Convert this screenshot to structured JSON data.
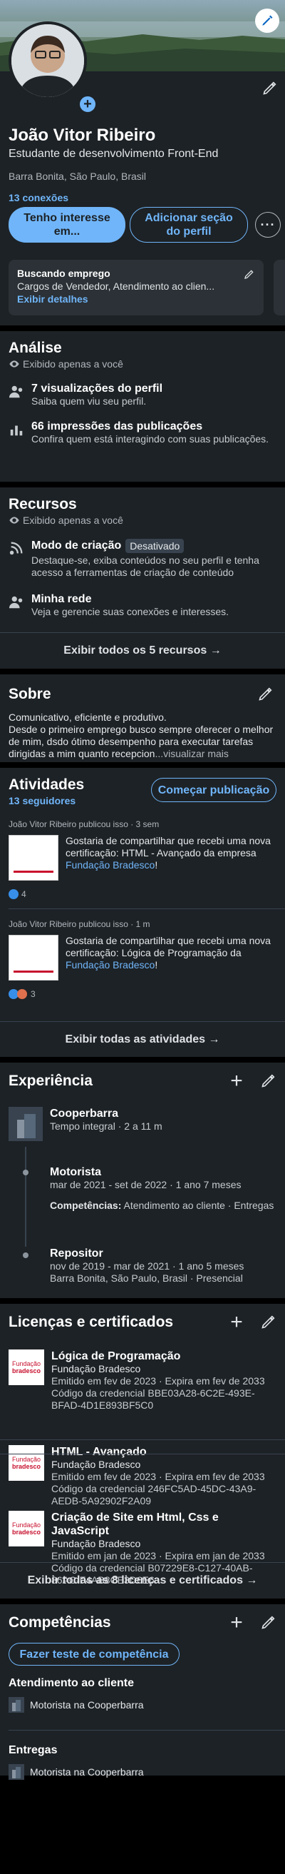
{
  "profile": {
    "name": "João Vitor Ribeiro",
    "headline": "Estudante de desenvolvimento Front-End",
    "location": "Barra Bonita, São Paulo, Brasil",
    "connections": "13 conexões",
    "btn_interest": "Tenho interesse em...",
    "btn_add_section": "Adicionar seção do perfil",
    "job_card": {
      "title": "Buscando emprego",
      "text": "Cargos de Vendedor, Atendimento ao clien...",
      "link": "Exibir detalhes"
    }
  },
  "analytics": {
    "title": "Análise",
    "private": "Exibido apenas a você",
    "items": [
      {
        "title": "7 visualizações do perfil",
        "sub": "Saiba quem viu seu perfil."
      },
      {
        "title": "66 impressões das publicações",
        "sub": "Confira quem está interagindo com suas publicações."
      }
    ]
  },
  "resources": {
    "title": "Recursos",
    "private": "Exibido apenas a você",
    "creator_title": "Modo de criação",
    "creator_badge": "Desativado",
    "creator_sub": "Destaque-se, exiba conteúdos no seu perfil e tenha acesso a ferramentas de criação de conteúdo",
    "network_title": "Minha rede",
    "network_sub": "Veja e gerencie suas conexões e interesses.",
    "show_all": "Exibir todos os 5 recursos →"
  },
  "about": {
    "title": "Sobre",
    "line1": "Comunicativo, eficiente e produtivo.",
    "line2": "Desde o primeiro emprego busco sempre oferecer o melhor de mim, dsdo ótimo desempenho para executar tarefas dirigidas a mim quanto recepcion",
    "more": "...visualizar mais"
  },
  "activity": {
    "title": "Atividades",
    "followers": "13 seguidores",
    "start_post": "Começar publicação",
    "posts": [
      {
        "header": "João Vitor Ribeiro publicou isso · 3 sem",
        "text": "Gostaria de compartilhar que recebi uma nova certificação: HTML - Avançado da empresa ",
        "org": "Fundação Bradesco",
        "tail": "!",
        "reactions": "4"
      },
      {
        "header": "João Vitor Ribeiro publicou isso · 1 m",
        "text": "Gostaria de compartilhar que recebi uma nova certificação: Lógica de Programação da ",
        "org": "Fundação Bradesco",
        "tail": "!",
        "reactions": "3"
      }
    ],
    "show_all": "Exibir todas as atividades →"
  },
  "experience": {
    "title": "Experiência",
    "company": "Cooperbarra",
    "company_sub": "Tempo integral · 2 a 11 m",
    "roles": [
      {
        "title": "Motorista",
        "dates": "mar de 2021 - set de 2022 · 1 ano 7 meses",
        "skills_label": "Competências:",
        "skills": " Atendimento ao cliente · Entregas"
      },
      {
        "title": "Repositor",
        "dates": "nov de 2019 - mar de 2021 · 1 ano 5 meses",
        "place": "Barra Bonita, São Paulo, Brasil · Presencial"
      }
    ]
  },
  "licenses": {
    "title": "Licenças e certificados",
    "logo_line1": "Fundação",
    "logo_line2": "bradesco",
    "items": [
      {
        "title": "Lógica de Programação",
        "issuer": "Fundação Bradesco",
        "issued": "Emitido em fev de 2023 · Expira em fev de 2033",
        "cred": "Código da credencial BBE03A28-6C2E-493E-BFAD-4D1E893BF5C0"
      },
      {
        "title": "HTML - Avançado",
        "issuer": "Fundação Bradesco",
        "issued": "Emitido em fev de 2023 · Expira em fev de 2033",
        "cred": "Código da credencial 246FC5AD-45DC-43A9-AEDB-5A92902F2A09"
      },
      {
        "title": "Criação de Site em Html, Css e JavaScript",
        "issuer": "Fundação Bradesco",
        "issued": "Emitido em jan de 2023 · Expira em jan de 2033",
        "cred": "Código da credencial B07229E8-C127-40AB-86AC-F4AB8CE3D6E6"
      }
    ],
    "show_all": "Exibir todas as 8 licenças e certificados →"
  },
  "skills": {
    "title": "Competências",
    "test_btn": "Fazer teste de competência",
    "items": [
      {
        "name": "Atendimento ao cliente",
        "context": "Motorista na Cooperbarra"
      },
      {
        "name": "Entregas",
        "context": "Motorista na Cooperbarra"
      }
    ]
  },
  "colors": {
    "accent": "#70b5f9",
    "card": "#1d2226",
    "brand_red": "#c8102e"
  }
}
